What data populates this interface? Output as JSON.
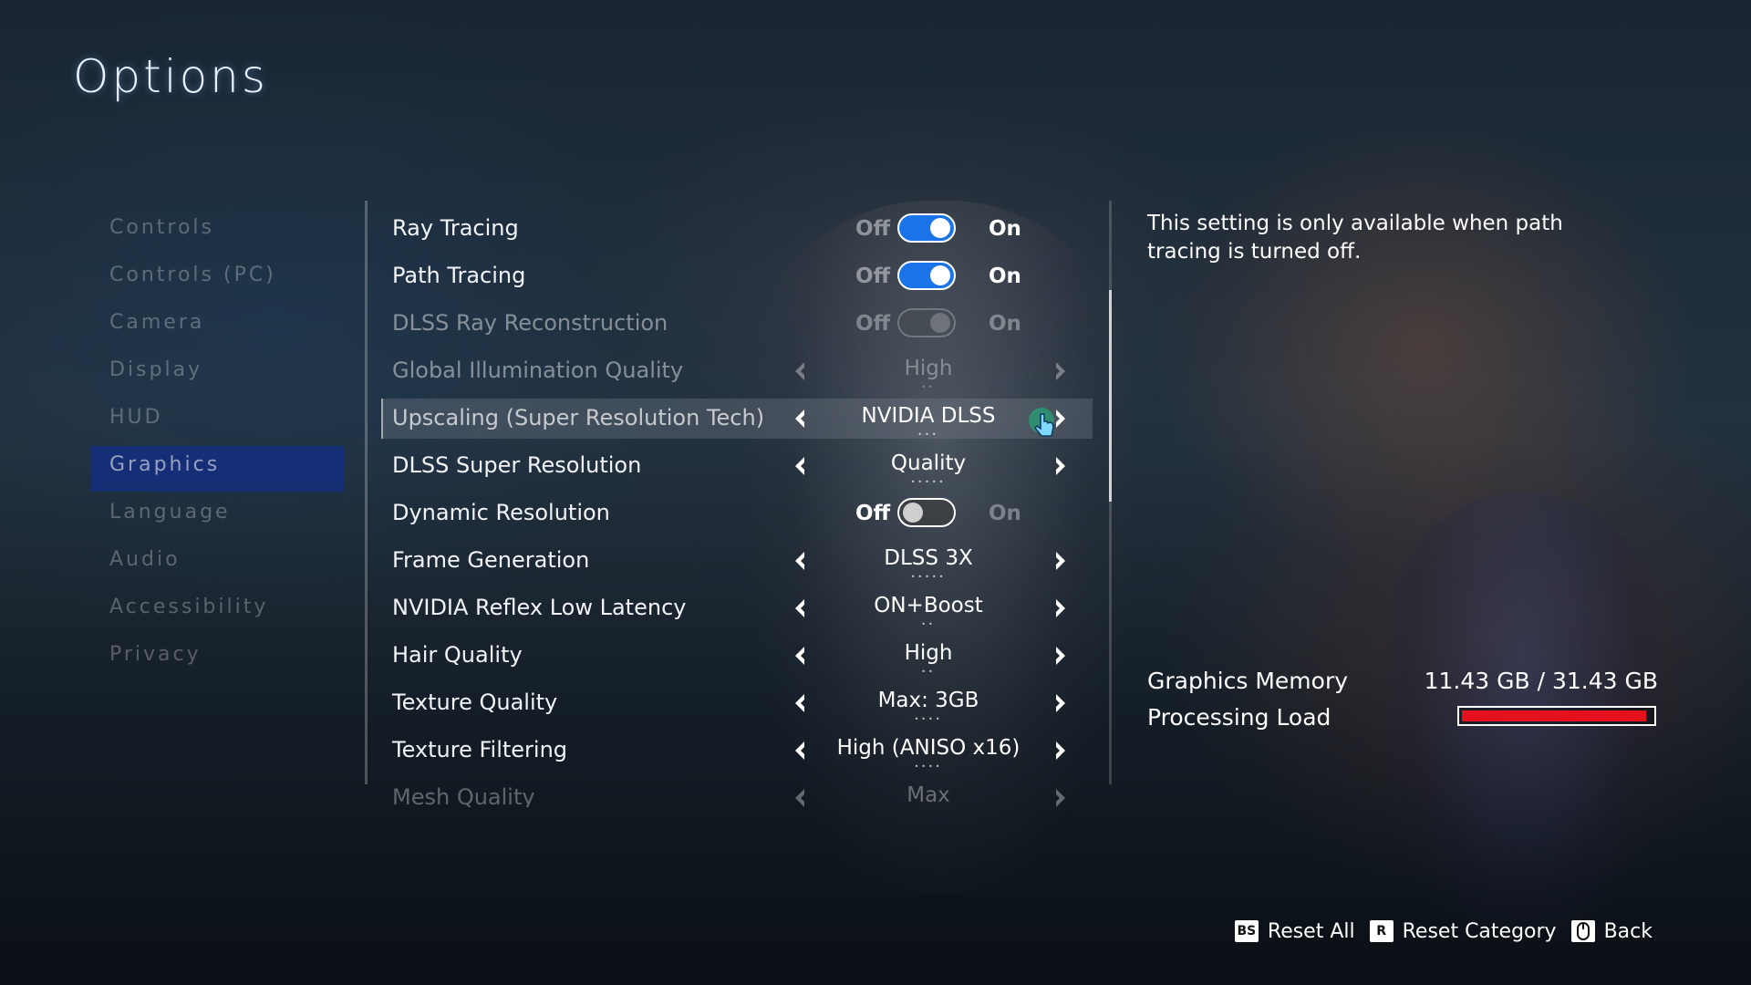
{
  "title": "Options",
  "nav": {
    "items": [
      {
        "label": "Controls"
      },
      {
        "label": "Controls (PC)"
      },
      {
        "label": "Camera"
      },
      {
        "label": "Display"
      },
      {
        "label": "HUD"
      },
      {
        "label": "Graphics",
        "active": true
      },
      {
        "label": "Language"
      },
      {
        "label": "Audio"
      },
      {
        "label": "Accessibility"
      },
      {
        "label": "Privacy"
      }
    ]
  },
  "settings": {
    "toggle_off_label": "Off",
    "toggle_on_label": "On",
    "rows": [
      {
        "label": "Ray Tracing",
        "type": "toggle",
        "state": "on"
      },
      {
        "label": "Path Tracing",
        "type": "toggle",
        "state": "on"
      },
      {
        "label": "DLSS Ray Reconstruction",
        "type": "toggle",
        "state": "disabled"
      },
      {
        "label": "Global Illumination Quality",
        "type": "selector",
        "value": "High",
        "dots": 2,
        "disabled": true
      },
      {
        "label": "Upscaling (Super Resolution Tech)",
        "type": "selector",
        "value": "NVIDIA DLSS",
        "dots": 3,
        "selected": true
      },
      {
        "label": "DLSS Super Resolution",
        "type": "selector",
        "value": "Quality",
        "dots": 5
      },
      {
        "label": "Dynamic Resolution",
        "type": "toggle",
        "state": "off"
      },
      {
        "label": "Frame Generation",
        "type": "selector",
        "value": "DLSS 3X",
        "dots": 5
      },
      {
        "label": "NVIDIA Reflex Low Latency",
        "type": "selector",
        "value": "ON+Boost",
        "dots": 2
      },
      {
        "label": "Hair Quality",
        "type": "selector",
        "value": "High",
        "dots": 2
      },
      {
        "label": "Texture Quality",
        "type": "selector",
        "value": "Max: 3GB",
        "dots": 4
      },
      {
        "label": "Texture Filtering",
        "type": "selector",
        "value": "High (ANISO x16)",
        "dots": 4
      },
      {
        "label": "Mesh Quality",
        "type": "selector",
        "value": "Max",
        "dots": 0,
        "faded": true
      }
    ]
  },
  "description": "This setting is only available when path tracing is turned off.",
  "stats": {
    "memory_label": "Graphics Memory",
    "memory_value": "11.43 GB / 31.43 GB",
    "load_label": "Processing Load",
    "load_fraction": 0.97
  },
  "footer": {
    "reset_all_key": "BS",
    "reset_all_label": "Reset All",
    "reset_category_key": "R",
    "reset_category_label": "Reset Category",
    "back_key_icon": "mouse-icon",
    "back_label": "Back"
  },
  "colors": {
    "accent": "#1a73e8",
    "nav_active": "#17307a",
    "load_bar": "#e3121c"
  }
}
